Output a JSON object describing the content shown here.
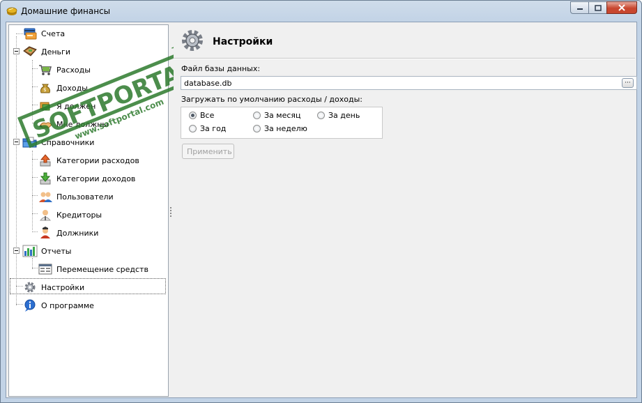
{
  "window": {
    "title": "Домашние финансы"
  },
  "tree": {
    "accounts": "Счета",
    "money": "Деньги",
    "expenses": "Расходы",
    "income": "Доходы",
    "i_owe": "Я должен",
    "owed_to_me": "Мне должны",
    "references": "Справочники",
    "expense_categories": "Категории расходов",
    "income_categories": "Категории доходов",
    "users": "Пользователи",
    "creditors": "Кредиторы",
    "debtors": "Должники",
    "reports": "Отчеты",
    "funds_transfer": "Перемещение средств",
    "settings": "Настройки",
    "about": "О программе"
  },
  "settings": {
    "title": "Настройки",
    "db_label": "Файл базы данных:",
    "db_value": "database.db",
    "browse_label": "···",
    "load_label": "Загружать по умолчанию расходы / доходы:",
    "radios": {
      "all": "Все",
      "month": "За месяц",
      "day": "За день",
      "year": "За год",
      "week": "За неделю"
    },
    "selected": "Все",
    "apply_label": "Применить"
  },
  "watermark": {
    "brand": "SOFTPORTAL",
    "url": "www.softportal.com",
    "tm": "TM"
  },
  "icons": {
    "app": "coins-icon",
    "accounts": "cards-icon",
    "money": "wallet-icon",
    "expenses": "cart-icon",
    "income": "money-bag-icon",
    "i_owe": "handshake-icon",
    "owed_to_me": "handshake-icon",
    "references": "folder-icon",
    "expense_categories": "arrow-up-icon",
    "income_categories": "arrow-down-icon",
    "users": "users-icon",
    "creditors": "creditor-icon",
    "debtors": "debtor-icon",
    "reports": "bar-chart-icon",
    "funds_transfer": "report-icon",
    "settings": "gear-icon",
    "about": "info-icon"
  },
  "colors": {
    "title_bar": "#c2d3e6",
    "close": "#c8472f",
    "watermark": "#2d7a2d"
  }
}
